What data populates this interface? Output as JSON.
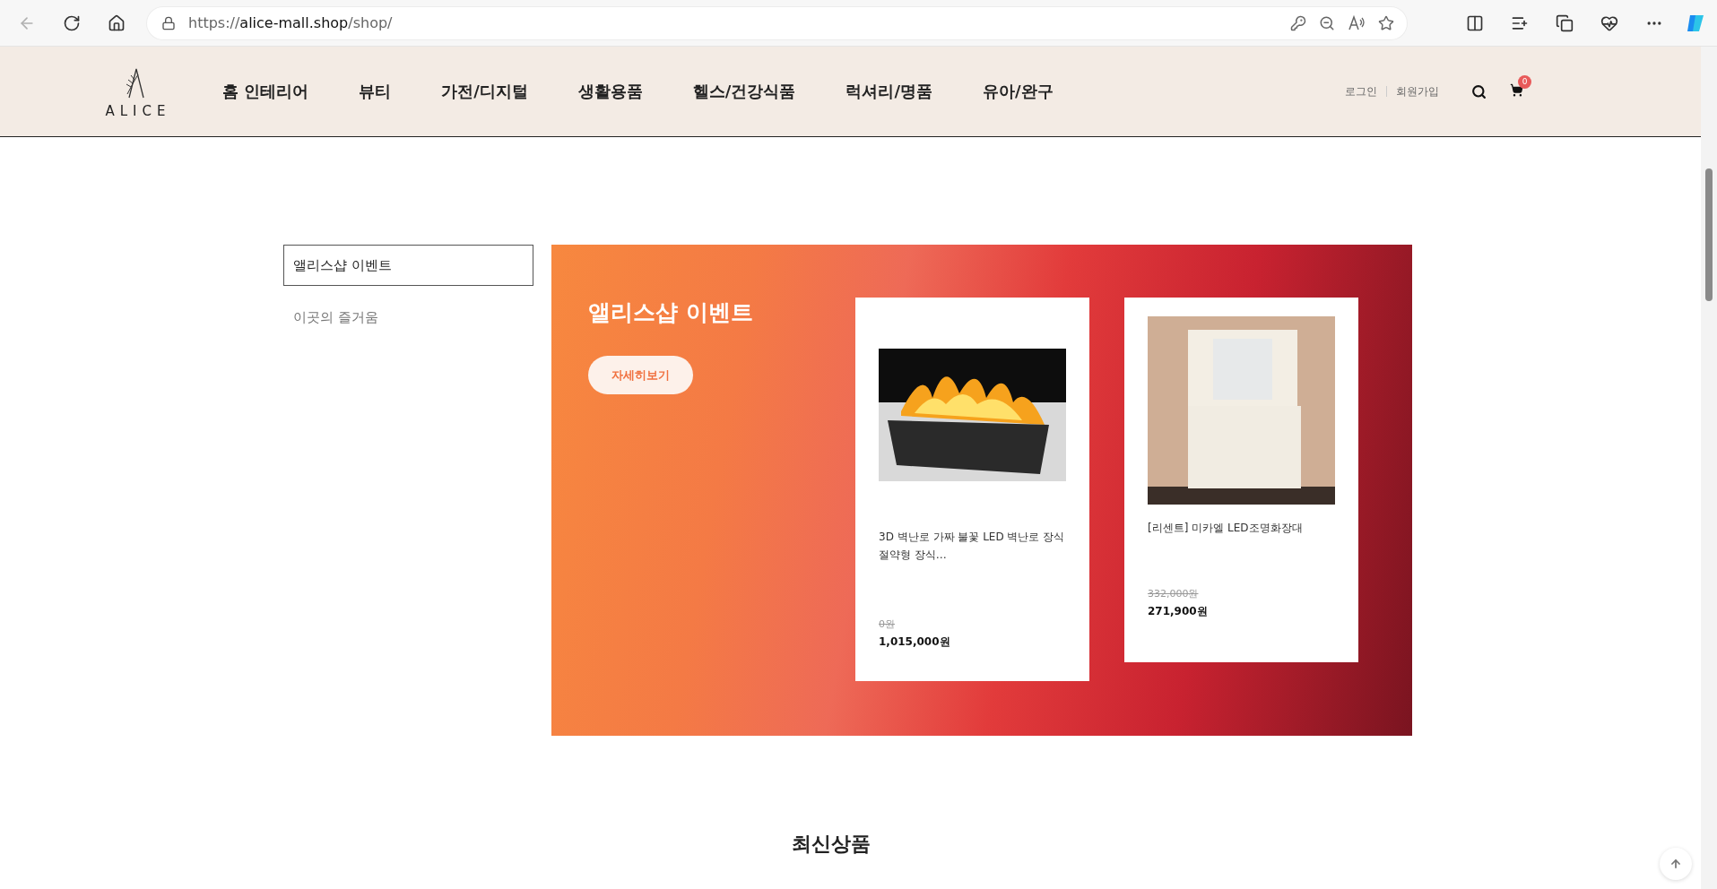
{
  "browser": {
    "url": {
      "scheme": "https://",
      "host": "alice-mall.shop",
      "path": "/shop/"
    }
  },
  "header": {
    "logo_text": "ALICE",
    "nav": [
      "홈 인테리어",
      "뷰티",
      "가전/디지털",
      "생활용품",
      "헬스/건강식품",
      "럭셔리/명품",
      "유아/완구"
    ],
    "account_links": [
      "로그인",
      "회원가입"
    ],
    "cart_count": "0"
  },
  "sidebar": {
    "items": [
      {
        "label": "앨리스샵 이벤트",
        "selected": true
      },
      {
        "label": "이곳의 즐거움",
        "selected": false
      }
    ]
  },
  "banner": {
    "title": "앨리스샵 이벤트",
    "button": "자세히보기",
    "products": [
      {
        "kind": "fireplace",
        "name": "3D 벽난로 가짜 불꽃 LED 벽난로 장식 절약형 장식…",
        "original_price": "0원",
        "price": "1,015,000원"
      },
      {
        "kind": "vanity",
        "name": "[리센트] 미카엘 LED조명화장대",
        "original_price": "332,000원",
        "price": "271,900원"
      }
    ]
  },
  "section_title": "최신상품"
}
